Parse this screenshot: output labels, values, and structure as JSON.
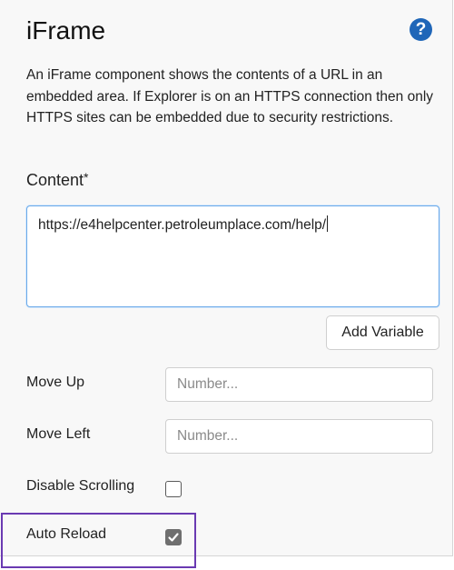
{
  "panel": {
    "title": "iFrame",
    "help_icon": "question-circle-icon",
    "description": "An iFrame component shows the contents of a URL in an embedded area. If Explorer is on an HTTPS connection then only HTTPS sites can be embedded due to security restrictions."
  },
  "content": {
    "label": "Content",
    "required_marker": "*",
    "value": "https://e4helpcenter.petroleumplace.com/help/"
  },
  "add_variable": {
    "label": "Add Variable"
  },
  "move_up": {
    "label": "Move Up",
    "placeholder": "Number..."
  },
  "move_left": {
    "label": "Move Left",
    "placeholder": "Number..."
  },
  "disable_scrolling": {
    "label": "Disable Scrolling",
    "checked": false
  },
  "auto_reload": {
    "label": "Auto Reload",
    "checked": true
  },
  "colors": {
    "help_icon": "#1f66b8",
    "focus_border": "#6aa9e9",
    "highlight_border": "#6a3ab2",
    "checked_fill": "#6f6f6f"
  }
}
